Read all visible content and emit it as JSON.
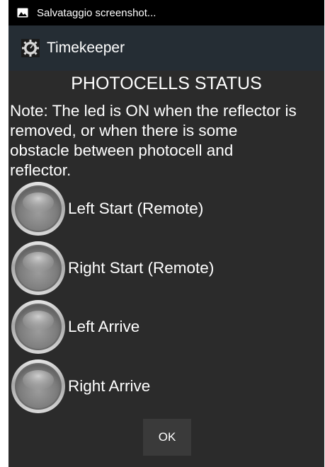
{
  "status_bar": {
    "icon": "image-icon",
    "text": "Salvataggio screenshot..."
  },
  "action_bar": {
    "icon": "gear-stopwatch-icon",
    "title": "Timekeeper"
  },
  "content": {
    "title": "PHOTOCELLS STATUS",
    "note_lines": [
      "Note: The led is ON when the reflector is",
      "removed, or when there is some",
      "obstacle between photocell and",
      "reflector."
    ],
    "leds": [
      {
        "label": "Left Start (Remote)",
        "state": "off"
      },
      {
        "label": "Right Start (Remote)",
        "state": "off"
      },
      {
        "label": "Left Arrive",
        "state": "off"
      },
      {
        "label": "Right Arrive",
        "state": "off"
      }
    ],
    "ok_label": "OK"
  },
  "colors": {
    "background": "#2b2b2b",
    "status_bar": "#000000",
    "action_bar": "#252d34",
    "text": "#ffffff",
    "button": "#3a3a3a"
  }
}
